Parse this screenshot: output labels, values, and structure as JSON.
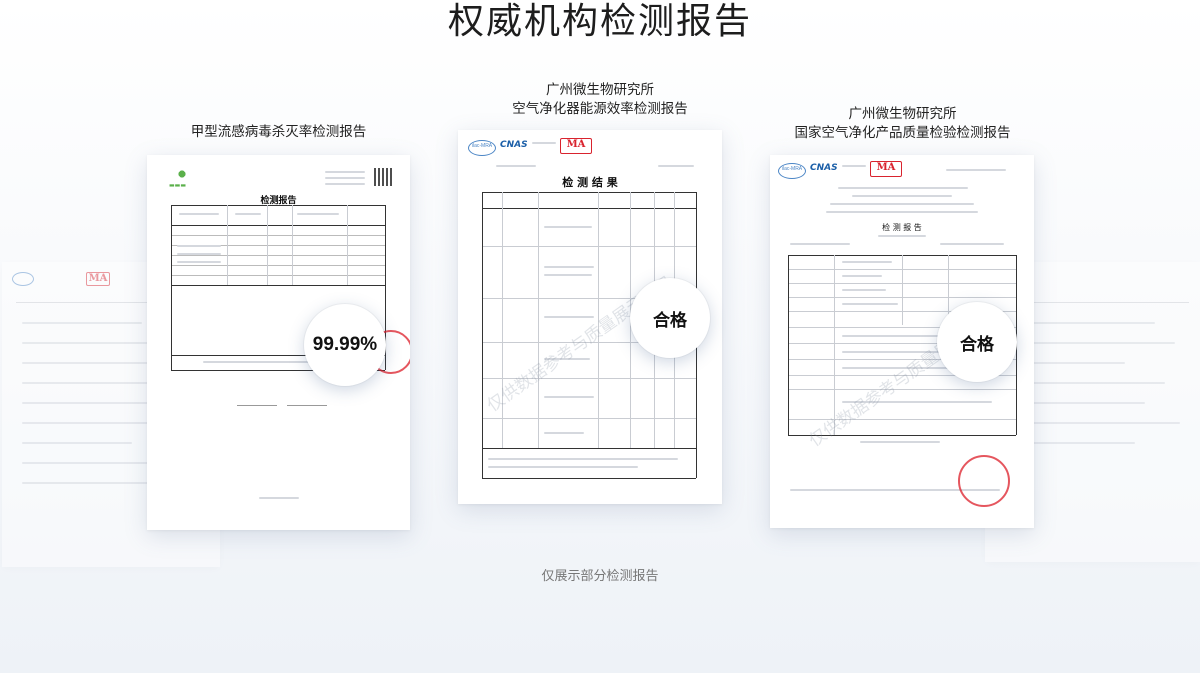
{
  "header": {
    "title": "权威机构检测报告"
  },
  "reports": [
    {
      "caption_lines": [
        "甲型流感病毒杀灭率检测报告"
      ],
      "badge": "99.99%",
      "doc_title": "检测报告"
    },
    {
      "caption_lines": [
        "广州微生物研究所",
        "空气净化器能源效率检测报告"
      ],
      "badge": "合格",
      "doc_title": "检 测 结 果"
    },
    {
      "caption_lines": [
        "广州微生物研究所",
        "国家空气净化产品质量检验检测报告"
      ],
      "badge": "合格",
      "doc_title": "检 测 报 告"
    }
  ],
  "footer": {
    "note": "仅展示部分检测报告"
  },
  "colors": {
    "cnas_blue": "#1b5fa8",
    "cma_red": "#d9232e",
    "stamp_red": "#dc1e28"
  }
}
